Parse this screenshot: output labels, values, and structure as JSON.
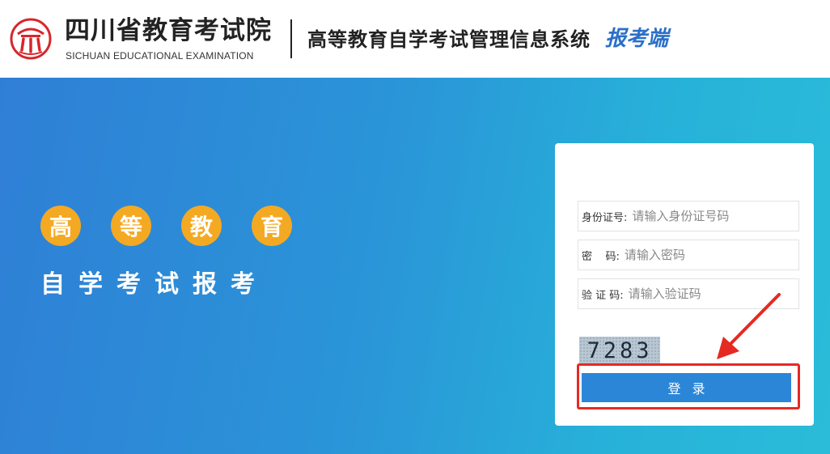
{
  "header": {
    "org_name": "四川省教育考试院",
    "org_name_en": "SICHUAN EDUCATIONAL EXAMINATION",
    "system_name": "高等教育自学考试管理信息系统",
    "system_suffix": "报考端",
    "logo_icon": "exam-institute-logo-icon"
  },
  "banner": {
    "circles": [
      "高",
      "等",
      "教",
      "育"
    ],
    "tagline": "自学考试报考"
  },
  "login": {
    "id_label": "身份证号:",
    "id_placeholder": "请输入身份证号码",
    "password_label": "密    码:",
    "password_placeholder": "请输入密码",
    "captcha_label": "验 证 码:",
    "captcha_placeholder": "请输入验证码",
    "captcha_text": "7283",
    "login_button": "登录"
  },
  "annotation": {
    "highlight_color": "#e52a23",
    "arrow_icon": "red-arrow-icon"
  },
  "colors": {
    "brand_red": "#d7262b",
    "accent_blue": "#2b6fc8",
    "button_blue": "#2c86d8",
    "circle_orange": "#f4a923"
  }
}
